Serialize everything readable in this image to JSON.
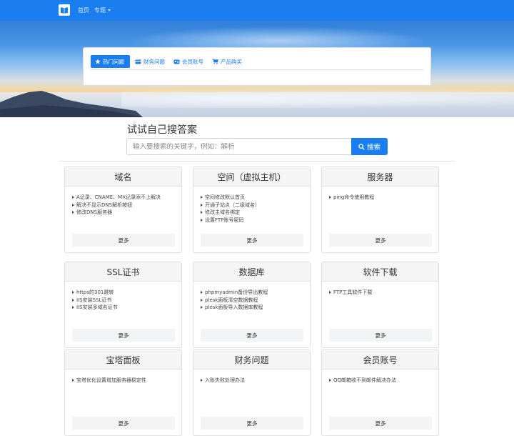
{
  "nav": {
    "home": "首页",
    "topics": "专题"
  },
  "tabs": [
    {
      "label": "热门问题",
      "icon": "star-icon"
    },
    {
      "label": "财务问题",
      "icon": "credit-card-icon"
    },
    {
      "label": "会员账号",
      "icon": "id-card-icon"
    },
    {
      "label": "产品购买",
      "icon": "cart-icon"
    }
  ],
  "search": {
    "heading": "试试自己搜答案",
    "placeholder": "输入要搜索的关键字，例如：解析",
    "button": "搜索"
  },
  "colors": {
    "accent": "#1a7ef0"
  },
  "cards": [
    {
      "title": "域名",
      "items": [
        "A记录、CNAME、MX记录添不上解决",
        "解决不显示DNS解析按钮",
        "修改DNS服务器"
      ],
      "more": "更多"
    },
    {
      "title": "空间（虚拟主机）",
      "items": [
        "空间修改默认首页",
        "开通子站点（二级域名）",
        "修改主域名绑定",
        "设置FTP账号密码"
      ],
      "more": "更多"
    },
    {
      "title": "服务器",
      "items": [
        "ping命令使用教程"
      ],
      "more": "更多"
    },
    {
      "title": "SSL证书",
      "items": [
        "https的301跳转",
        "IIS安装SSL证书",
        "IIS安装多域名证书"
      ],
      "more": "更多"
    },
    {
      "title": "数据库",
      "items": [
        "phpmyadmin备份导出教程",
        "plesk面板清空数据教程",
        "plesk面板导入数据库教程"
      ],
      "more": "更多"
    },
    {
      "title": "软件下载",
      "items": [
        "FTP工具软件下载"
      ],
      "more": "更多"
    },
    {
      "title": "宝塔面板",
      "items": [
        "宝塔优化设置增加服务器稳定性"
      ],
      "more": "更多"
    },
    {
      "title": "财务问题",
      "items": [
        "入账失败处理办法"
      ],
      "more": "更多"
    },
    {
      "title": "会员账号",
      "items": [
        "QQ邮箱收不到邮件解决办法"
      ],
      "more": "更多"
    }
  ]
}
